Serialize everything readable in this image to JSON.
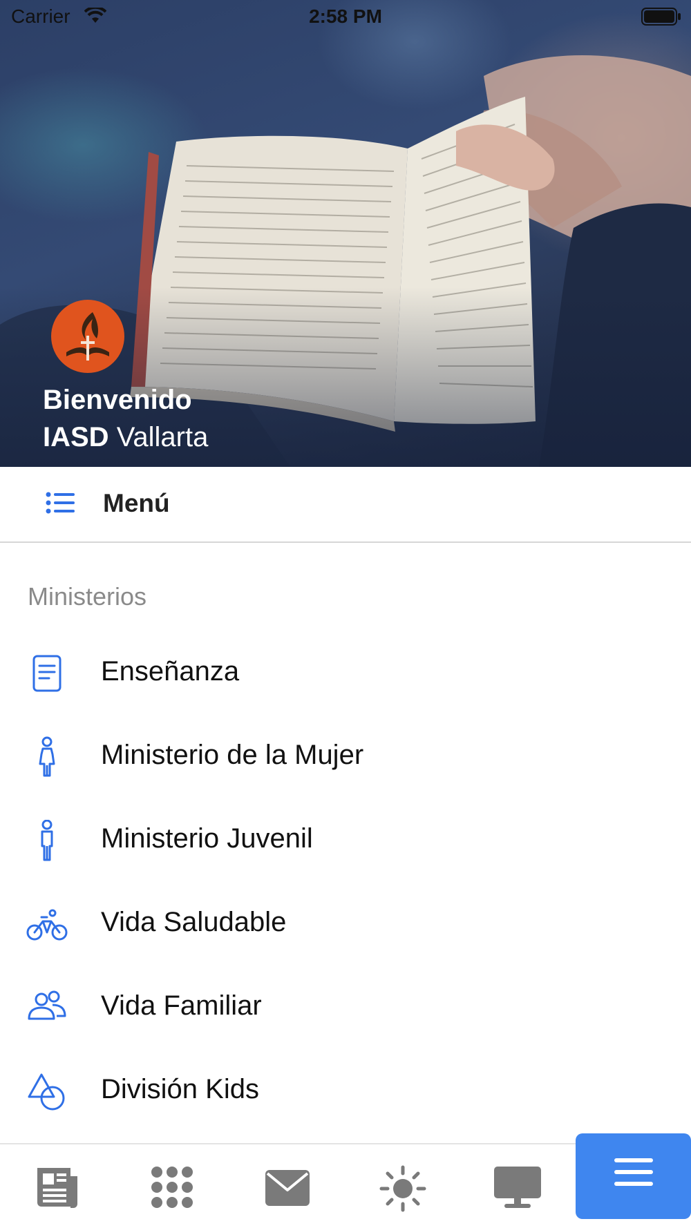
{
  "status_bar": {
    "carrier": "Carrier",
    "time": "2:58 PM"
  },
  "hero": {
    "welcome_line1": "Bienvenido",
    "welcome_org_bold": "IASD",
    "welcome_org_rest": " Vallarta"
  },
  "menu_header": {
    "title": "Menú",
    "icon": "list-icon"
  },
  "section": {
    "title": "Ministerios",
    "items": [
      {
        "label": "Enseñanza",
        "icon": "document-icon"
      },
      {
        "label": "Ministerio de la Mujer",
        "icon": "woman-icon"
      },
      {
        "label": "Ministerio Juvenil",
        "icon": "man-icon"
      },
      {
        "label": "Vida Saludable",
        "icon": "bicycle-icon"
      },
      {
        "label": "Vida Familiar",
        "icon": "people-icon"
      },
      {
        "label": "División Kids",
        "icon": "shapes-icon"
      }
    ]
  },
  "tab_bar": {
    "tabs": [
      {
        "icon": "newspaper-icon",
        "active": false
      },
      {
        "icon": "grid-dots-icon",
        "active": false
      },
      {
        "icon": "envelope-icon",
        "active": false
      },
      {
        "icon": "sun-icon",
        "active": false
      },
      {
        "icon": "monitor-icon",
        "active": false
      },
      {
        "icon": "hamburger-menu-icon",
        "active": true
      }
    ]
  },
  "colors": {
    "accent": "#3f86ef",
    "icon_blue": "#2f6fe6",
    "logo_orange": "#e0541e",
    "tab_icon_gray": "#7a7a7a",
    "section_gray": "#8a8a8a"
  }
}
